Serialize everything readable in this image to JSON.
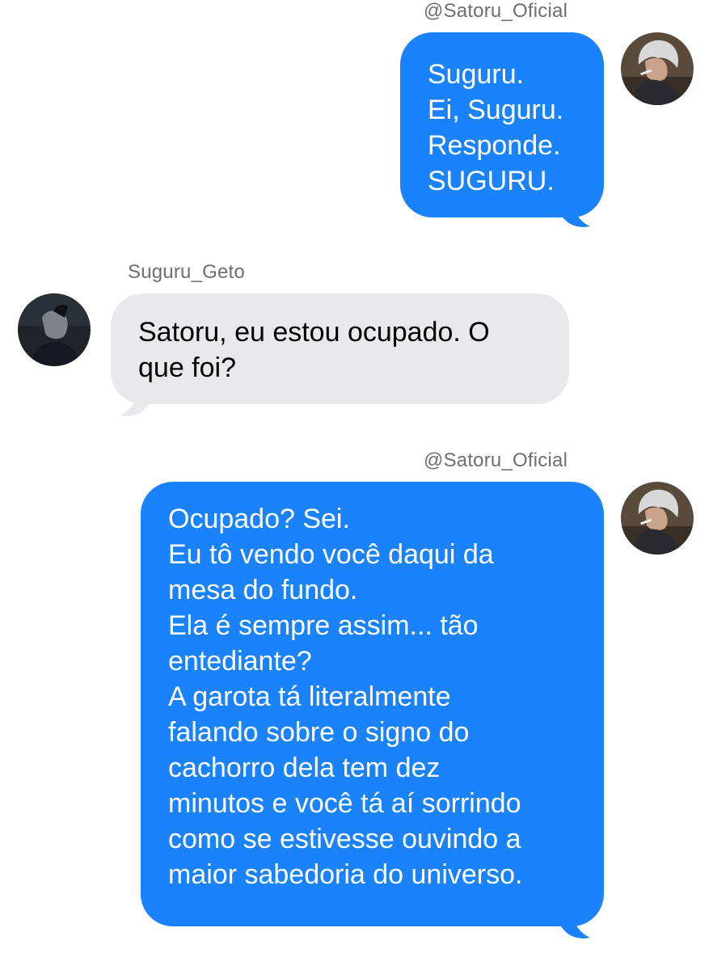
{
  "messages": [
    {
      "direction": "outgoing",
      "sender": "@Satoru_Oficial",
      "avatar": "satoru-avatar",
      "lines": [
        "Suguru.",
        "Ei, Suguru.",
        "Responde.",
        "SUGURU."
      ]
    },
    {
      "direction": "incoming",
      "sender": "Suguru_Geto",
      "avatar": "suguru-avatar",
      "lines": [
        "Satoru, eu estou ocupado. O",
        "que foi?"
      ]
    },
    {
      "direction": "outgoing",
      "sender": "@Satoru_Oficial",
      "avatar": "satoru-avatar",
      "lines": [
        "Ocupado? Sei.",
        "Eu tô vendo você daqui da",
        "mesa do fundo.",
        "Ela é sempre assim... tão",
        "entediante?",
        "A garota tá literalmente",
        "falando sobre o signo do",
        "cachorro dela tem dez",
        "minutos e você tá aí sorrindo",
        "como se estivesse ouvindo a",
        "maior sabedoria do universo."
      ]
    }
  ],
  "colors": {
    "outgoing_bubble": "#1a82fb",
    "incoming_bubble": "#e9e9eb",
    "sender_label": "#6e6e73"
  }
}
